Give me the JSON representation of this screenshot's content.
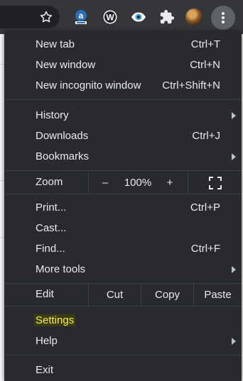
{
  "colors": {
    "toolbar_bg": "#35363a",
    "menu_bg": "#292a2d",
    "menu_text": "#e8eaed",
    "separator": "#3c4043",
    "highlight_text": "#f6f05a"
  },
  "toolbar": {
    "icons": [
      "star-icon",
      "amazon-extension-icon",
      "w-extension-icon",
      "eye-extension-icon",
      "puzzle-extensions-icon",
      "profile-avatar",
      "more-menu-icon"
    ],
    "w_letter": "W",
    "a_letter": "a"
  },
  "menu": {
    "new_tab": {
      "label": "New tab",
      "shortcut": "Ctrl+T"
    },
    "new_window": {
      "label": "New window",
      "shortcut": "Ctrl+N"
    },
    "new_incognito": {
      "label": "New incognito window",
      "shortcut": "Ctrl+Shift+N"
    },
    "history": {
      "label": "History"
    },
    "downloads": {
      "label": "Downloads",
      "shortcut": "Ctrl+J"
    },
    "bookmarks": {
      "label": "Bookmarks"
    },
    "zoom": {
      "label": "Zoom",
      "minus": "–",
      "value": "100%",
      "plus": "+"
    },
    "print": {
      "label": "Print...",
      "shortcut": "Ctrl+P"
    },
    "cast": {
      "label": "Cast..."
    },
    "find": {
      "label": "Find...",
      "shortcut": "Ctrl+F"
    },
    "more_tools": {
      "label": "More tools"
    },
    "edit": {
      "label": "Edit",
      "cut": "Cut",
      "copy": "Copy",
      "paste": "Paste"
    },
    "settings": {
      "label": "Settings"
    },
    "help": {
      "label": "Help"
    },
    "exit": {
      "label": "Exit"
    }
  }
}
